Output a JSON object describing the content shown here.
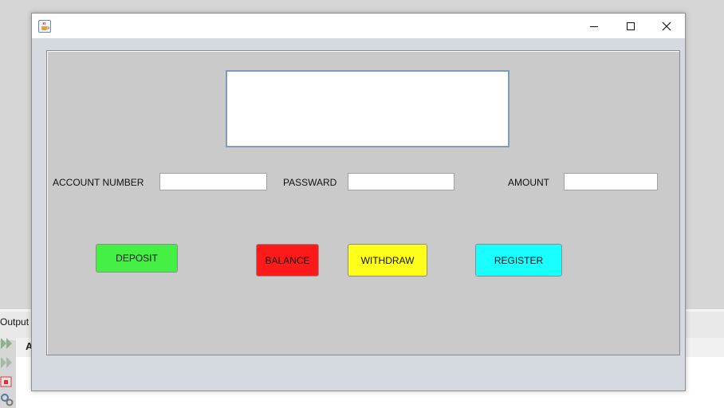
{
  "background": {
    "output_label": "Output",
    "partial_text": "A"
  },
  "window": {
    "icon": "java-cup-icon",
    "controls": {
      "minimize": "minimize-icon",
      "maximize": "maximize-icon",
      "close": "close-icon"
    }
  },
  "form": {
    "display_value": "",
    "account_number_label": "ACCOUNT NUMBER",
    "account_number_value": "",
    "password_label": "PASSWARD",
    "password_value": "",
    "amount_label": "AMOUNT",
    "amount_value": ""
  },
  "buttons": {
    "deposit": {
      "label": "DEPOSIT",
      "color": "#44f044"
    },
    "balance": {
      "label": "BALANCE",
      "color": "#ff1a1a"
    },
    "withdraw": {
      "label": "WITHDRAW",
      "color": "#ffff19"
    },
    "register": {
      "label": "REGISTER",
      "color": "#19ffff"
    }
  }
}
